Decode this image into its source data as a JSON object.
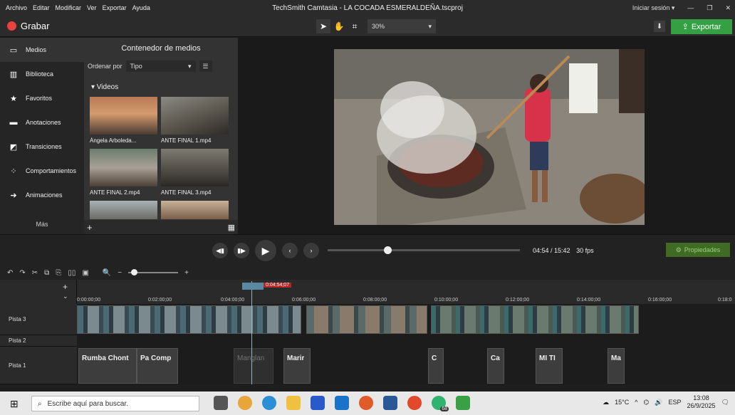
{
  "app": {
    "title": "TechSmith Camtasia - LA COCADA ESMERALDEÑA.tscproj",
    "menu": [
      "Archivo",
      "Editar",
      "Modificar",
      "Ver",
      "Exportar",
      "Ayuda"
    ],
    "signin": "Iniciar sesión ▾"
  },
  "toolbar": {
    "record_label": "Grabar",
    "zoom_value": "30%",
    "export_label": "Exportar"
  },
  "sidebar": {
    "items": [
      {
        "label": "Medios",
        "icon": "media-icon"
      },
      {
        "label": "Biblioteca",
        "icon": "library-icon"
      },
      {
        "label": "Favoritos",
        "icon": "star-icon"
      },
      {
        "label": "Anotaciones",
        "icon": "annotation-icon"
      },
      {
        "label": "Transiciones",
        "icon": "transition-icon"
      },
      {
        "label": "Comportamientos",
        "icon": "behavior-icon"
      },
      {
        "label": "Animaciones",
        "icon": "animation-icon"
      }
    ],
    "more_label": "Más"
  },
  "media_bin": {
    "title": "Contenedor de medios",
    "sort_label": "Ordenar por",
    "sort_value": "Tipo",
    "videos_header": "▾ Videos",
    "items": [
      {
        "label": "Ángela Arboleda..."
      },
      {
        "label": "ANTE FINAL 1.mp4"
      },
      {
        "label": "ANTE FINAL 2.mp4"
      },
      {
        "label": "ANTE FINAL 3.mp4"
      }
    ]
  },
  "playback": {
    "time_display": "04:54 / 15:42",
    "fps": "30 fps",
    "progress": 0.31,
    "properties_label": "Propiedades"
  },
  "timeline": {
    "playhead_time": "0:04:54;07",
    "ruler": [
      "0:00:00;00",
      "0:02:00;00",
      "0:04:00;00",
      "0:06:00;00",
      "0:08:00;00",
      "0:10:00;00",
      "0:12:00;00",
      "0:14:00;00",
      "0:16:00;00",
      "0:18:0"
    ],
    "tracks": [
      {
        "label": "Pista 3"
      },
      {
        "label": "Pista 2"
      },
      {
        "label": "Pista 1"
      }
    ],
    "track1_clips": [
      "Rumba Chont",
      "Pa Comp",
      "Manglan",
      "Marir",
      "C",
      "Ca",
      "MI TI",
      "Ma"
    ]
  },
  "taskbar": {
    "search_placeholder": "Escribe aquí para buscar.",
    "weather": "15°C",
    "lang": "ESP",
    "time": "13:08",
    "date": "26/9/2025",
    "badge": "68"
  },
  "colors": {
    "accent": "#34a043",
    "record": "#e8433c",
    "playhead_label": "#b02727"
  }
}
